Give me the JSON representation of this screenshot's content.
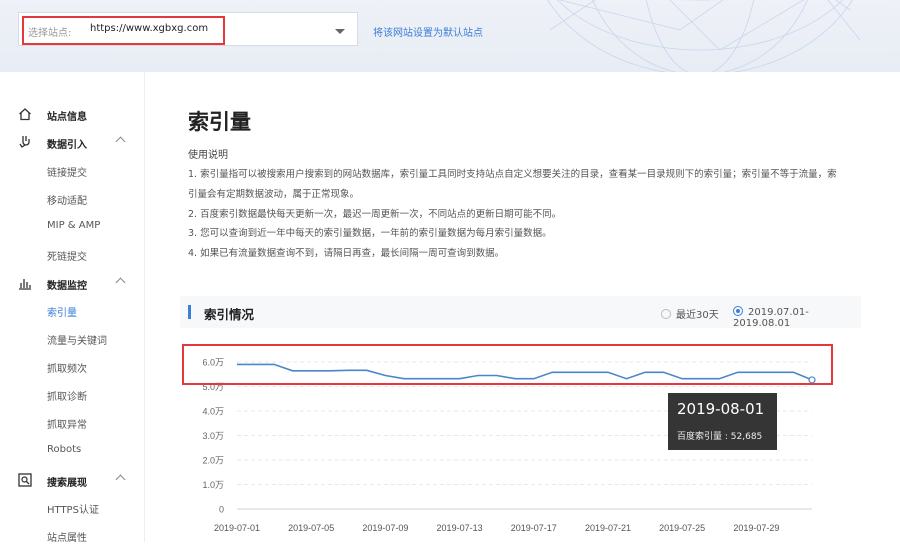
{
  "site_bar": {
    "label": "选择站点:",
    "value": "https://www.xgbxg.com",
    "set_default": "将该网站设置为默认站点"
  },
  "sidebar": {
    "groups": [
      {
        "label": "站点信息",
        "icon": "home-icon",
        "items": []
      },
      {
        "label": "数据引入",
        "icon": "data-import-icon",
        "items": [
          "链接提交",
          "移动适配",
          "MIP & AMP",
          "死链提交"
        ]
      },
      {
        "label": "数据监控",
        "icon": "bar-chart-icon",
        "items": [
          "索引量",
          "流量与关键词",
          "抓取频次",
          "抓取诊断",
          "抓取异常",
          "Robots"
        ]
      },
      {
        "label": "搜索展现",
        "icon": "search-display-icon",
        "items": [
          "HTTPS认证",
          "站点属性"
        ]
      }
    ],
    "active_item": "索引量"
  },
  "main": {
    "title": "索引量",
    "usage_title": "使用说明",
    "usage_lines": [
      "1. 索引量指可以被搜索用户搜索到的网站数据库，索引量工具同时支持站点自定义想要关注的目录，查看某一目录规则下的索引量；索引量不等于流量，索",
      "引量会有定期数据波动，属于正常现象。",
      "2. 百度索引数据最快每天更新一次，最迟一周更新一次，不同站点的更新日期可能不同。",
      "3. 您可以查询到近一年中每天的索引量数据，一年前的索引量数据为每月索引量数据。",
      "4. 如果已有流量数据查询不到，请隔日再查，最长间隔一周可查询到数据。"
    ],
    "section_title": "索引情况",
    "range_options": [
      "最近30天",
      "2019.07.01-2019.08.01"
    ],
    "selected_range": "2019.07.01-2019.08.01"
  },
  "tooltip": {
    "date": "2019-08-01",
    "label": "百度索引量",
    "value": "52,685"
  },
  "colors": {
    "accent": "#3a7ed8",
    "highlight": "#e6383c",
    "line": "#4a86c8"
  },
  "chart_data": {
    "type": "line",
    "ylim": [
      0,
      60000
    ],
    "y_ticks": [
      0,
      10000,
      20000,
      30000,
      40000,
      50000,
      60000
    ],
    "y_tick_labels": [
      "0",
      "1.0万",
      "2.0万",
      "3.0万",
      "4.0万",
      "5.0万",
      "6.0万"
    ],
    "x_tick_labels": [
      "2019-07-01",
      "2019-07-05",
      "2019-07-09",
      "2019-07-13",
      "2019-07-17",
      "2019-07-21",
      "2019-07-25",
      "2019-07-29"
    ],
    "series": [
      {
        "x": [
          "2019-07-01",
          "2019-07-02",
          "2019-07-03",
          "2019-07-04",
          "2019-07-05",
          "2019-07-06",
          "2019-07-07",
          "2019-07-08",
          "2019-07-09",
          "2019-07-10",
          "2019-07-11",
          "2019-07-12",
          "2019-07-13",
          "2019-07-14",
          "2019-07-15",
          "2019-07-16",
          "2019-07-17",
          "2019-07-18",
          "2019-07-19",
          "2019-07-20",
          "2019-07-21",
          "2019-07-22",
          "2019-07-23",
          "2019-07-24",
          "2019-07-25",
          "2019-07-26",
          "2019-07-27",
          "2019-07-28",
          "2019-07-29",
          "2019-07-30",
          "2019-07-31",
          "2019-08-01"
        ],
        "values": [
          59000,
          59000,
          59000,
          56400,
          56400,
          56400,
          56600,
          56600,
          54500,
          53200,
          53200,
          53200,
          53200,
          54500,
          54500,
          53200,
          53200,
          55800,
          55800,
          55800,
          55800,
          53200,
          55800,
          55800,
          53200,
          53200,
          53200,
          55800,
          55800,
          55800,
          55800,
          52685
        ]
      }
    ]
  }
}
